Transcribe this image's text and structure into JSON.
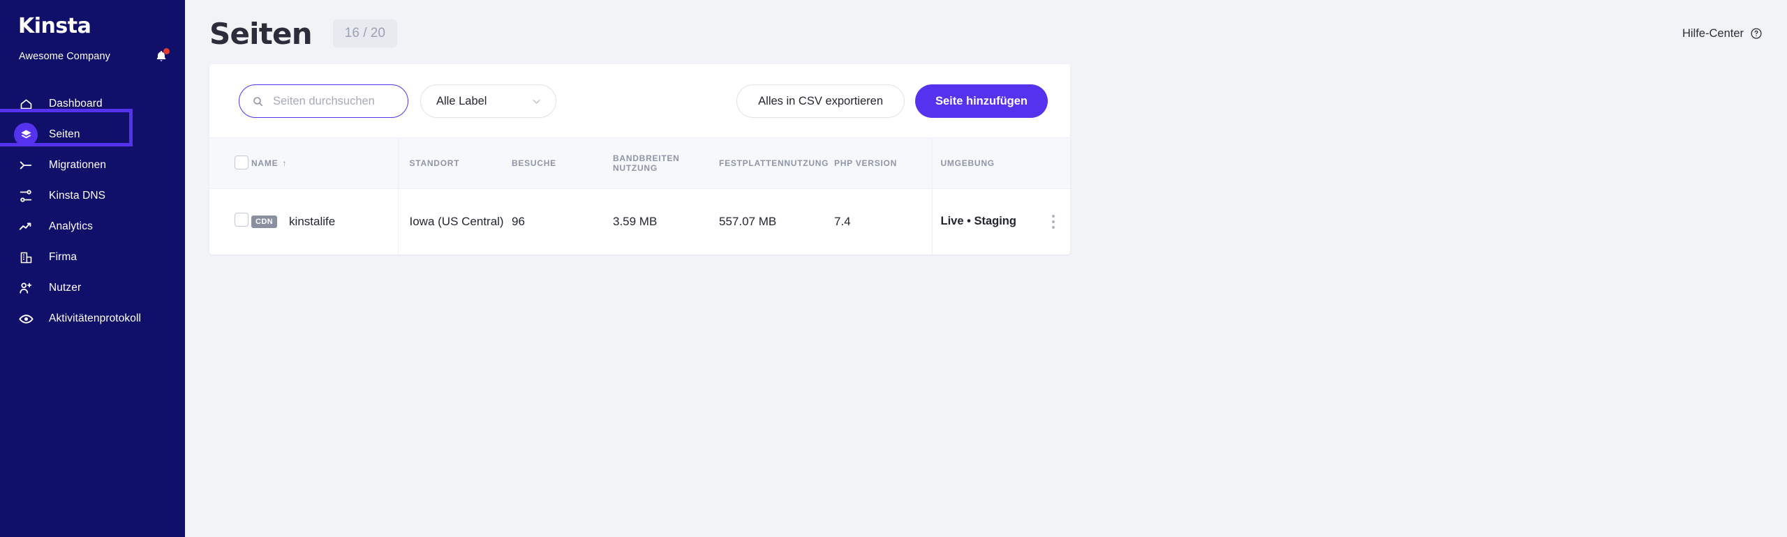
{
  "sidebar": {
    "brand": "Kinsta",
    "company": "Awesome Company",
    "bell_icon": "bell-icon",
    "items": [
      {
        "label": "Dashboard",
        "icon": "home-icon",
        "active": false
      },
      {
        "label": "Seiten",
        "icon": "layers-icon",
        "active": true
      },
      {
        "label": "Migrationen",
        "icon": "migrate-icon",
        "active": false
      },
      {
        "label": "Kinsta DNS",
        "icon": "dns-icon",
        "active": false
      },
      {
        "label": "Analytics",
        "icon": "trend-up-icon",
        "active": false
      },
      {
        "label": "Firma",
        "icon": "building-icon",
        "active": false
      },
      {
        "label": "Nutzer",
        "icon": "user-plus-icon",
        "active": false
      },
      {
        "label": "Aktivitätenprotokoll",
        "icon": "eye-icon",
        "active": false
      }
    ]
  },
  "header": {
    "title": "Seiten",
    "count_badge": "16 / 20",
    "help_label": "Hilfe-Center",
    "help_icon": "question-circle-icon"
  },
  "toolbar": {
    "search_placeholder": "Seiten durchsuchen",
    "search_value": "",
    "search_icon": "search-icon",
    "label_filter_value": "Alle Label",
    "label_filter_icon": "chevron-down-icon",
    "export_label": "Alles in CSV exportieren",
    "add_site_label": "Seite hinzufügen"
  },
  "table": {
    "columns": [
      {
        "key": "check",
        "label": ""
      },
      {
        "key": "name",
        "label": "NAME",
        "sort": "↑"
      },
      {
        "key": "location",
        "label": "STANDORT"
      },
      {
        "key": "visits",
        "label": "BESUCHE"
      },
      {
        "key": "bandwidth_l1",
        "label": "BANDBREITEN",
        "label_l2": "NUTZUNG"
      },
      {
        "key": "disk",
        "label": "FESTPLATTENNUTZUNG"
      },
      {
        "key": "php",
        "label": "PHP VERSION"
      },
      {
        "key": "env",
        "label": "UMGEBUNG"
      }
    ],
    "rows": [
      {
        "badge": "CDN",
        "name": "kinstalife",
        "location": "Iowa (US Central)",
        "visits": "96",
        "bandwidth": "3.59 MB",
        "disk": "557.07 MB",
        "php": "7.4",
        "env": "Live • Staging",
        "menu_icon": "kebab-menu-icon"
      }
    ]
  },
  "colors": {
    "sidebar_bg": "#10106b",
    "accent": "#5533ee",
    "page_bg": "#f1f3f7",
    "notification_dot": "#e03c31",
    "badge_bg": "#8b90a0"
  }
}
